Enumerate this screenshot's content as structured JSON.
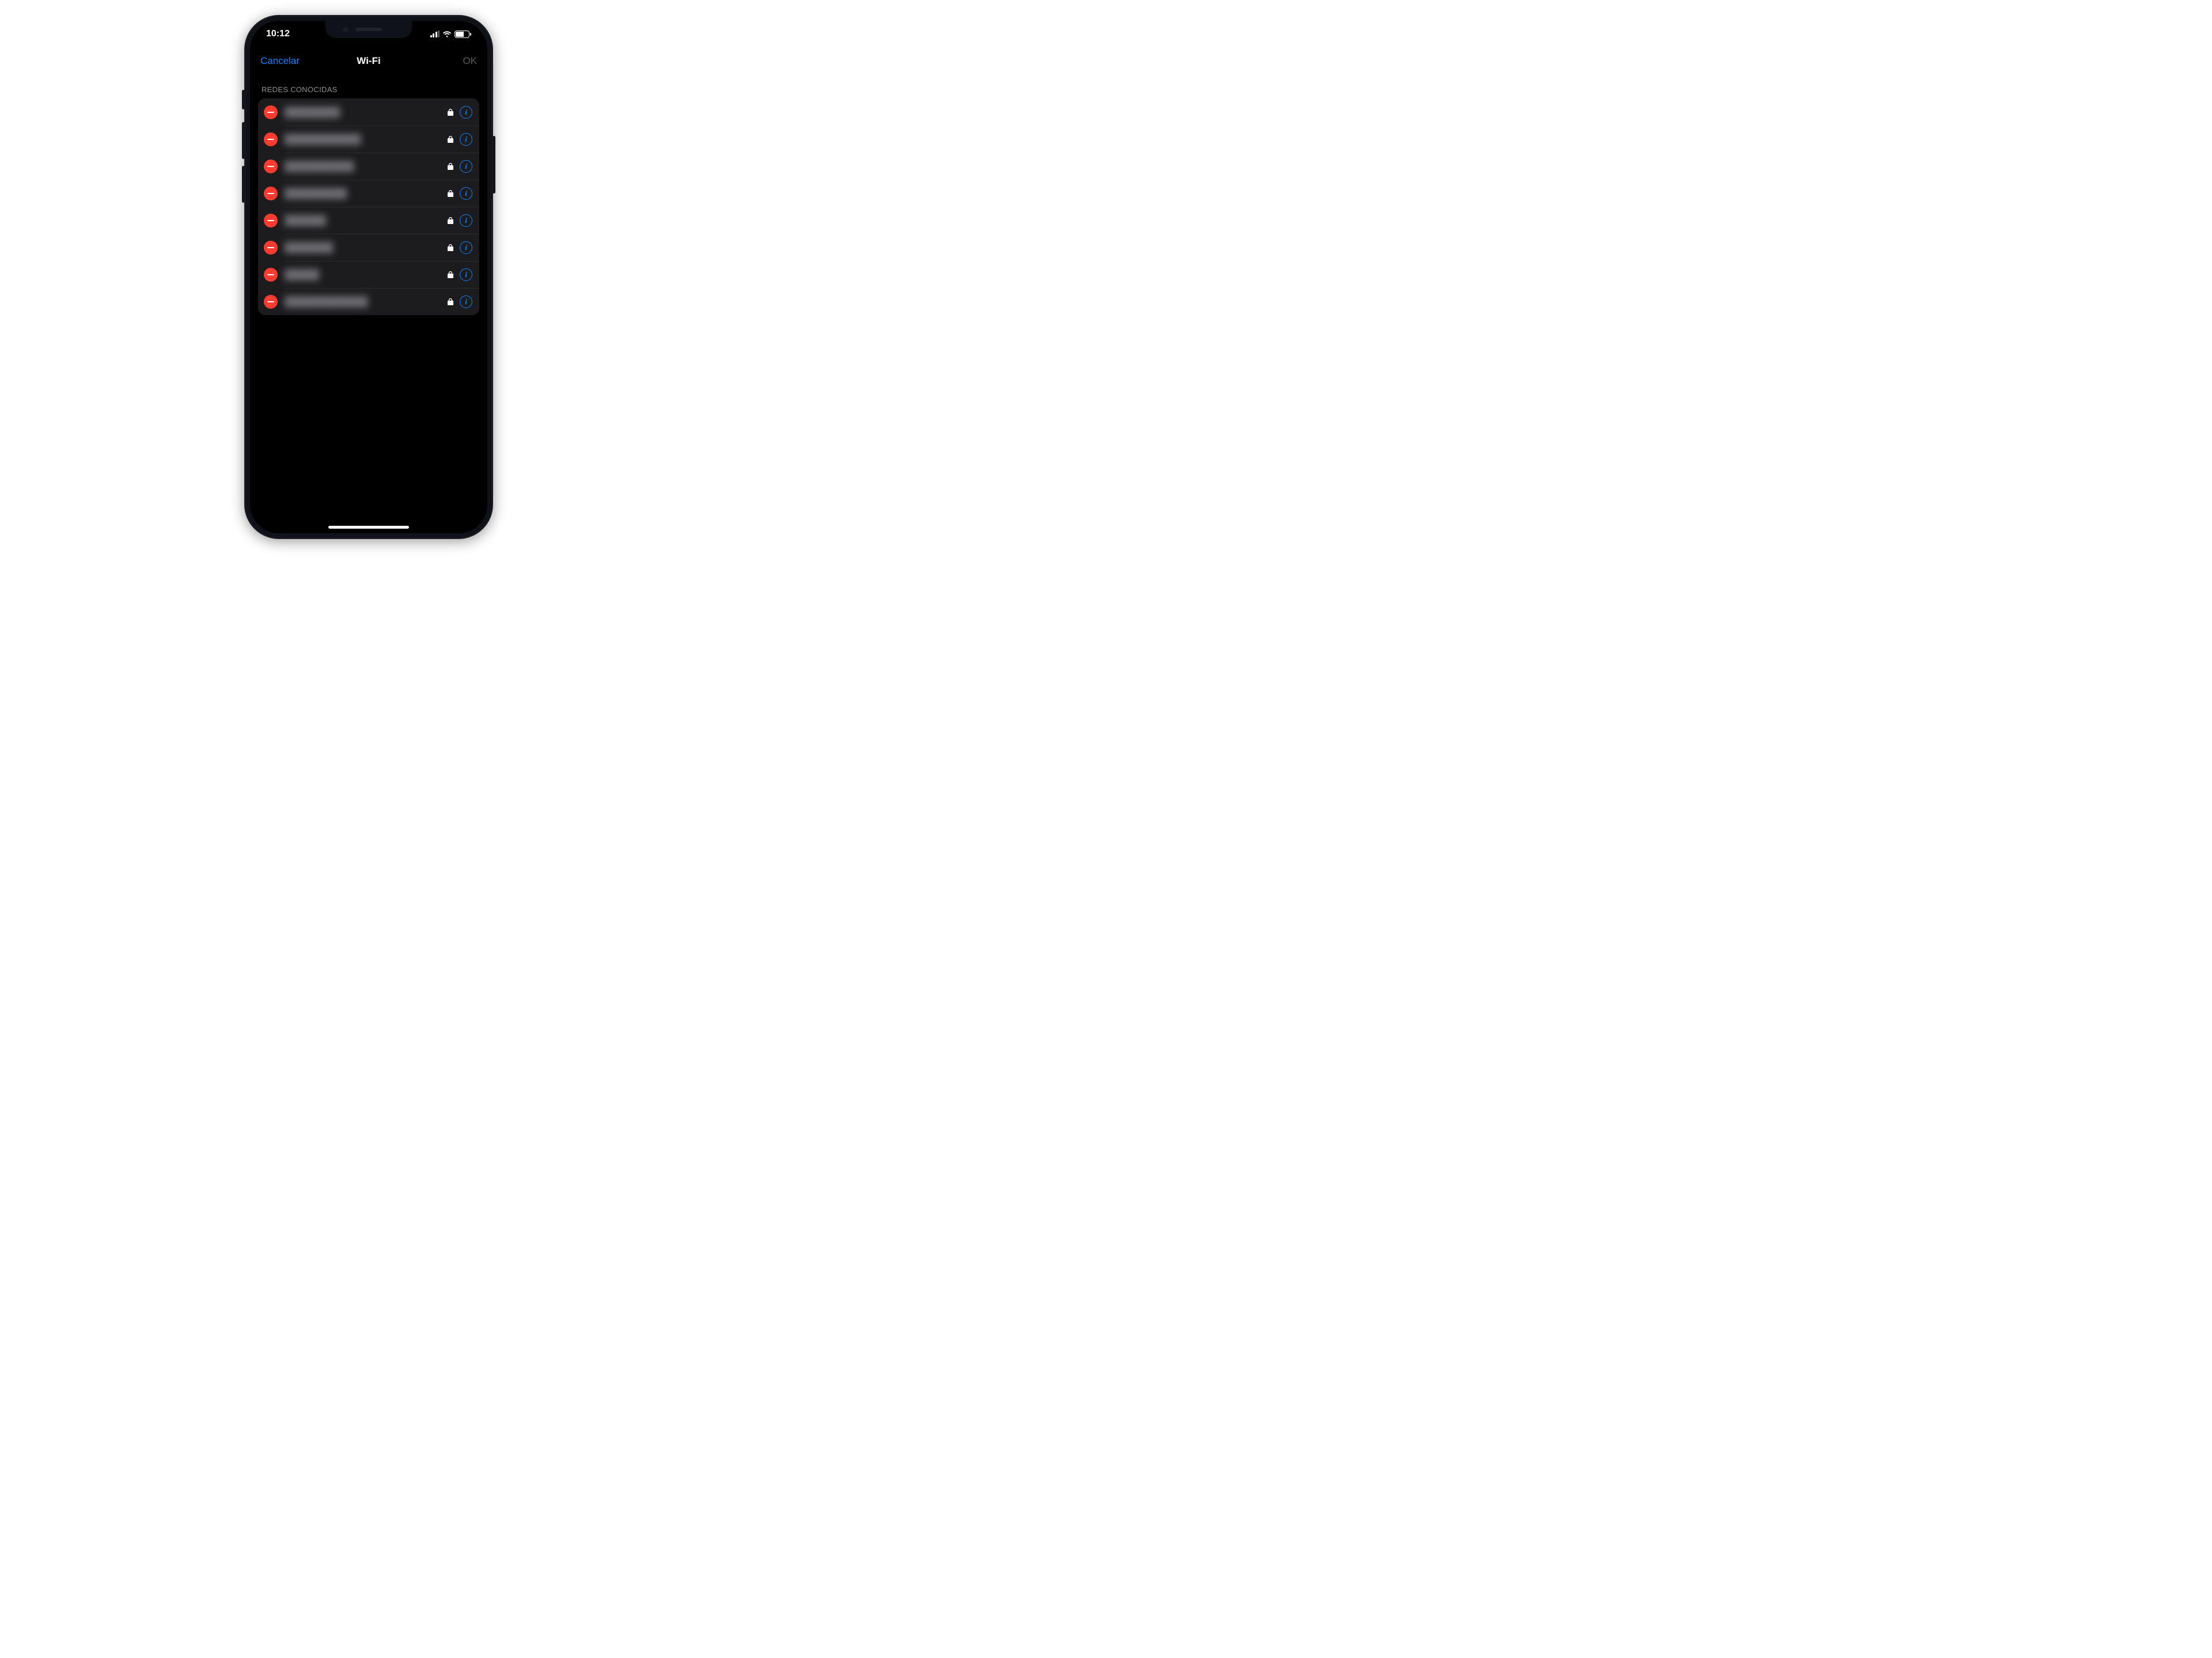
{
  "status": {
    "time": "10:12",
    "battery_pct": "62"
  },
  "nav": {
    "cancel": "Cancelar",
    "title": "Wi-Fi",
    "ok": "OK"
  },
  "section": {
    "known_title": "REDES CONOCIDAS"
  },
  "networks": [
    {
      "name": "████████"
    },
    {
      "name": "███████████"
    },
    {
      "name": "██████████"
    },
    {
      "name": "█████████"
    },
    {
      "name": "██████"
    },
    {
      "name": "███████"
    },
    {
      "name": "█████"
    },
    {
      "name": "████████████"
    }
  ],
  "colors": {
    "accent": "#0a84ff",
    "destructive": "#ff3b30"
  }
}
